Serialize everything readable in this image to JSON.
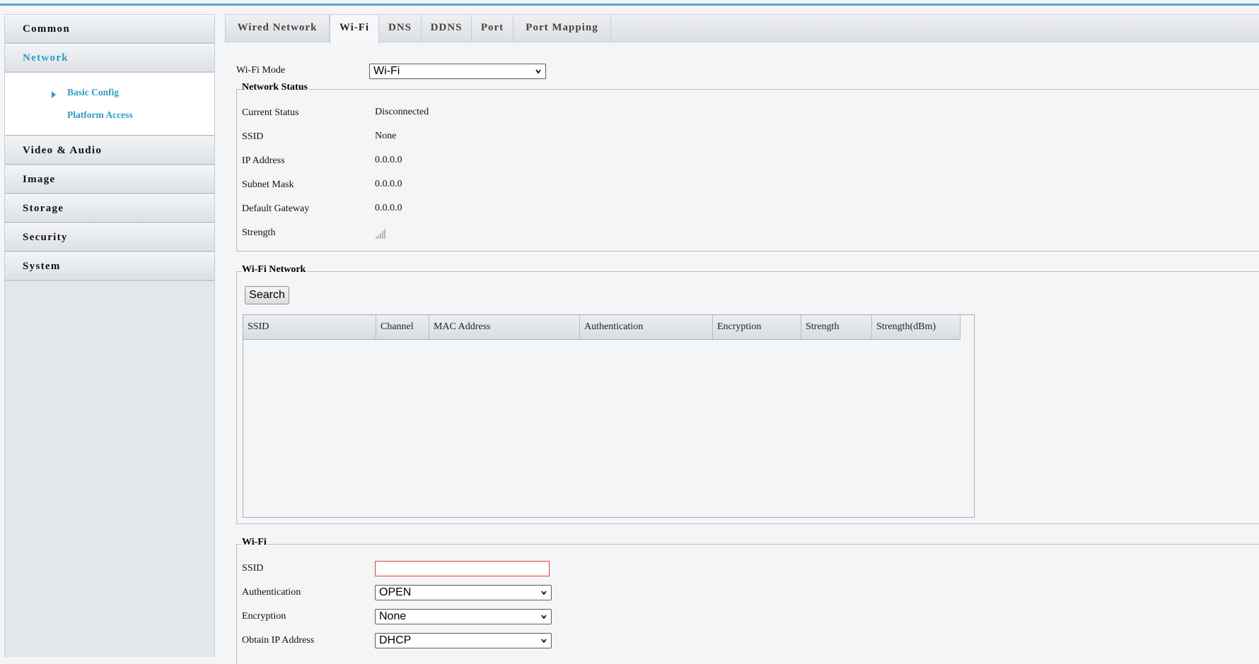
{
  "sidebar": {
    "items": [
      {
        "label": "Common"
      },
      {
        "label": "Network"
      },
      {
        "label": "Video & Audio"
      },
      {
        "label": "Image"
      },
      {
        "label": "Storage"
      },
      {
        "label": "Security"
      },
      {
        "label": "System"
      }
    ],
    "network_sub": [
      {
        "label": "Basic Config"
      },
      {
        "label": "Platform Access"
      }
    ]
  },
  "tabs": [
    {
      "label": "Wired Network"
    },
    {
      "label": "Wi-Fi"
    },
    {
      "label": "DNS"
    },
    {
      "label": "DDNS"
    },
    {
      "label": "Port"
    },
    {
      "label": "Port Mapping"
    }
  ],
  "wifi_mode": {
    "label": "Wi-Fi Mode",
    "value": "Wi-Fi"
  },
  "network_status": {
    "legend": "Network Status",
    "rows": [
      {
        "label": "Current Status",
        "value": "Disconnected"
      },
      {
        "label": "SSID",
        "value": "None"
      },
      {
        "label": "IP Address",
        "value": "0.0.0.0"
      },
      {
        "label": "Subnet Mask",
        "value": "0.0.0.0"
      },
      {
        "label": "Default Gateway",
        "value": "0.0.0.0"
      },
      {
        "label": "Strength",
        "value": ""
      }
    ],
    "strength_icon": "signal-bars-icon"
  },
  "wifi_network": {
    "legend": "Wi-Fi Network",
    "search_label": "Search",
    "columns": [
      "SSID",
      "Channel",
      "MAC Address",
      "Authentication",
      "Encryption",
      "Strength",
      "Strength(dBm)"
    ]
  },
  "wifi": {
    "legend": "Wi-Fi",
    "ssid": {
      "label": "SSID",
      "value": ""
    },
    "authentication": {
      "label": "Authentication",
      "value": "OPEN"
    },
    "encryption": {
      "label": "Encryption",
      "value": "None"
    },
    "obtain_ip": {
      "label": "Obtain IP Address",
      "value": "DHCP"
    }
  },
  "colors": {
    "accent": "#2d9bc7",
    "top_line": "#5aa4d4",
    "error_border": "#e04040"
  }
}
